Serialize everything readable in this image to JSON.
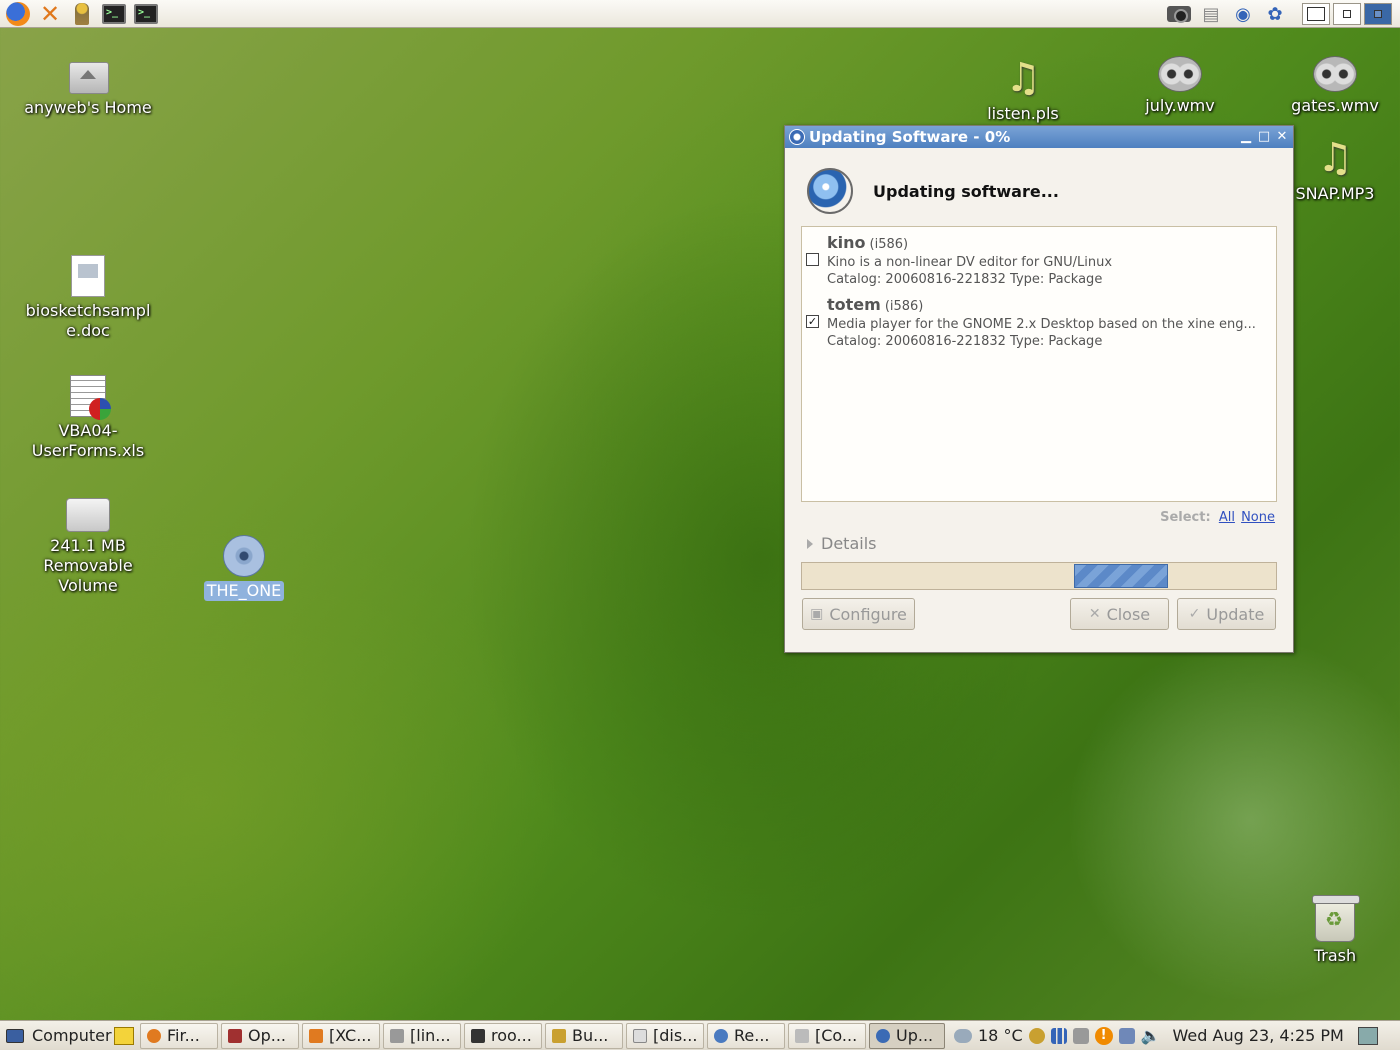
{
  "top_panel": {
    "launchers": [
      "firefox-icon",
      "xchat-icon",
      "user-icon",
      "terminal-icon",
      "terminal-icon"
    ],
    "tray_icons": [
      "camera-icon",
      "store-icon",
      "network-icon",
      "network-icon"
    ]
  },
  "desktop": {
    "icons": [
      {
        "label": "anyweb's Home"
      },
      {
        "label": "biosketchsample.doc",
        "line1": "biosketchsampl",
        "line2": "e.doc"
      },
      {
        "label": "VBA04-UserForms.xls",
        "line1": "VBA04-",
        "line2": "UserForms.xls"
      },
      {
        "label": "241.1 MB Removable Volume",
        "line1": "241.1 MB",
        "line2": "Removable",
        "line3": "Volume"
      },
      {
        "label": "THE_ONE"
      },
      {
        "label": "listen.pls"
      },
      {
        "label": "july.wmv"
      },
      {
        "label": "gates.wmv"
      },
      {
        "label": "SNAP.MP3"
      },
      {
        "label": "Trash"
      }
    ]
  },
  "dialog": {
    "title": "Updating Software - 0%",
    "heading": "Updating software...",
    "packages": [
      {
        "name": "kino",
        "arch": "(i586)",
        "checked": false,
        "description": "Kino is a non-linear DV editor for GNU/Linux",
        "catalog": "Catalog: 20060816-221832 Type: Package"
      },
      {
        "name": "totem",
        "arch": "(i586)",
        "checked": true,
        "description": "Media player for the GNOME 2.x Desktop based on the xine eng...",
        "catalog": "Catalog: 20060816-221832 Type: Package"
      }
    ],
    "select_label": "Select:",
    "select_all": "All",
    "select_none": "None",
    "details_label": "Details",
    "progress": 0,
    "buttons": {
      "configure": "Configure",
      "close": "Close",
      "update": "Update"
    }
  },
  "bottom_panel": {
    "computer_label": "Computer",
    "tasks": [
      "Fir...",
      "Op...",
      "[XC...",
      "[lin...",
      "roo...",
      "Bu...",
      "[dis...",
      "Re...",
      "[Co...",
      "Up..."
    ],
    "weather": "18 °C",
    "clock": "Wed Aug 23,  4:25 PM"
  },
  "colors": {
    "titlebar": "#4e80c0",
    "progress_pulse": "#5c89c8",
    "selection": "#8fb2dd"
  }
}
